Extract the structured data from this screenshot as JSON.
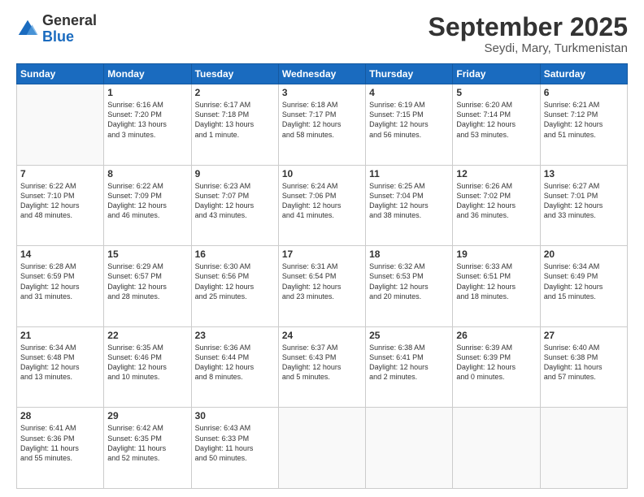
{
  "logo": {
    "general": "General",
    "blue": "Blue"
  },
  "title": "September 2025",
  "location": "Seydi, Mary, Turkmenistan",
  "days_of_week": [
    "Sunday",
    "Monday",
    "Tuesday",
    "Wednesday",
    "Thursday",
    "Friday",
    "Saturday"
  ],
  "weeks": [
    [
      {
        "day": "",
        "info": ""
      },
      {
        "day": "1",
        "info": "Sunrise: 6:16 AM\nSunset: 7:20 PM\nDaylight: 13 hours\nand 3 minutes."
      },
      {
        "day": "2",
        "info": "Sunrise: 6:17 AM\nSunset: 7:18 PM\nDaylight: 13 hours\nand 1 minute."
      },
      {
        "day": "3",
        "info": "Sunrise: 6:18 AM\nSunset: 7:17 PM\nDaylight: 12 hours\nand 58 minutes."
      },
      {
        "day": "4",
        "info": "Sunrise: 6:19 AM\nSunset: 7:15 PM\nDaylight: 12 hours\nand 56 minutes."
      },
      {
        "day": "5",
        "info": "Sunrise: 6:20 AM\nSunset: 7:14 PM\nDaylight: 12 hours\nand 53 minutes."
      },
      {
        "day": "6",
        "info": "Sunrise: 6:21 AM\nSunset: 7:12 PM\nDaylight: 12 hours\nand 51 minutes."
      }
    ],
    [
      {
        "day": "7",
        "info": "Sunrise: 6:22 AM\nSunset: 7:10 PM\nDaylight: 12 hours\nand 48 minutes."
      },
      {
        "day": "8",
        "info": "Sunrise: 6:22 AM\nSunset: 7:09 PM\nDaylight: 12 hours\nand 46 minutes."
      },
      {
        "day": "9",
        "info": "Sunrise: 6:23 AM\nSunset: 7:07 PM\nDaylight: 12 hours\nand 43 minutes."
      },
      {
        "day": "10",
        "info": "Sunrise: 6:24 AM\nSunset: 7:06 PM\nDaylight: 12 hours\nand 41 minutes."
      },
      {
        "day": "11",
        "info": "Sunrise: 6:25 AM\nSunset: 7:04 PM\nDaylight: 12 hours\nand 38 minutes."
      },
      {
        "day": "12",
        "info": "Sunrise: 6:26 AM\nSunset: 7:02 PM\nDaylight: 12 hours\nand 36 minutes."
      },
      {
        "day": "13",
        "info": "Sunrise: 6:27 AM\nSunset: 7:01 PM\nDaylight: 12 hours\nand 33 minutes."
      }
    ],
    [
      {
        "day": "14",
        "info": "Sunrise: 6:28 AM\nSunset: 6:59 PM\nDaylight: 12 hours\nand 31 minutes."
      },
      {
        "day": "15",
        "info": "Sunrise: 6:29 AM\nSunset: 6:57 PM\nDaylight: 12 hours\nand 28 minutes."
      },
      {
        "day": "16",
        "info": "Sunrise: 6:30 AM\nSunset: 6:56 PM\nDaylight: 12 hours\nand 25 minutes."
      },
      {
        "day": "17",
        "info": "Sunrise: 6:31 AM\nSunset: 6:54 PM\nDaylight: 12 hours\nand 23 minutes."
      },
      {
        "day": "18",
        "info": "Sunrise: 6:32 AM\nSunset: 6:53 PM\nDaylight: 12 hours\nand 20 minutes."
      },
      {
        "day": "19",
        "info": "Sunrise: 6:33 AM\nSunset: 6:51 PM\nDaylight: 12 hours\nand 18 minutes."
      },
      {
        "day": "20",
        "info": "Sunrise: 6:34 AM\nSunset: 6:49 PM\nDaylight: 12 hours\nand 15 minutes."
      }
    ],
    [
      {
        "day": "21",
        "info": "Sunrise: 6:34 AM\nSunset: 6:48 PM\nDaylight: 12 hours\nand 13 minutes."
      },
      {
        "day": "22",
        "info": "Sunrise: 6:35 AM\nSunset: 6:46 PM\nDaylight: 12 hours\nand 10 minutes."
      },
      {
        "day": "23",
        "info": "Sunrise: 6:36 AM\nSunset: 6:44 PM\nDaylight: 12 hours\nand 8 minutes."
      },
      {
        "day": "24",
        "info": "Sunrise: 6:37 AM\nSunset: 6:43 PM\nDaylight: 12 hours\nand 5 minutes."
      },
      {
        "day": "25",
        "info": "Sunrise: 6:38 AM\nSunset: 6:41 PM\nDaylight: 12 hours\nand 2 minutes."
      },
      {
        "day": "26",
        "info": "Sunrise: 6:39 AM\nSunset: 6:39 PM\nDaylight: 12 hours\nand 0 minutes."
      },
      {
        "day": "27",
        "info": "Sunrise: 6:40 AM\nSunset: 6:38 PM\nDaylight: 11 hours\nand 57 minutes."
      }
    ],
    [
      {
        "day": "28",
        "info": "Sunrise: 6:41 AM\nSunset: 6:36 PM\nDaylight: 11 hours\nand 55 minutes."
      },
      {
        "day": "29",
        "info": "Sunrise: 6:42 AM\nSunset: 6:35 PM\nDaylight: 11 hours\nand 52 minutes."
      },
      {
        "day": "30",
        "info": "Sunrise: 6:43 AM\nSunset: 6:33 PM\nDaylight: 11 hours\nand 50 minutes."
      },
      {
        "day": "",
        "info": ""
      },
      {
        "day": "",
        "info": ""
      },
      {
        "day": "",
        "info": ""
      },
      {
        "day": "",
        "info": ""
      }
    ]
  ]
}
